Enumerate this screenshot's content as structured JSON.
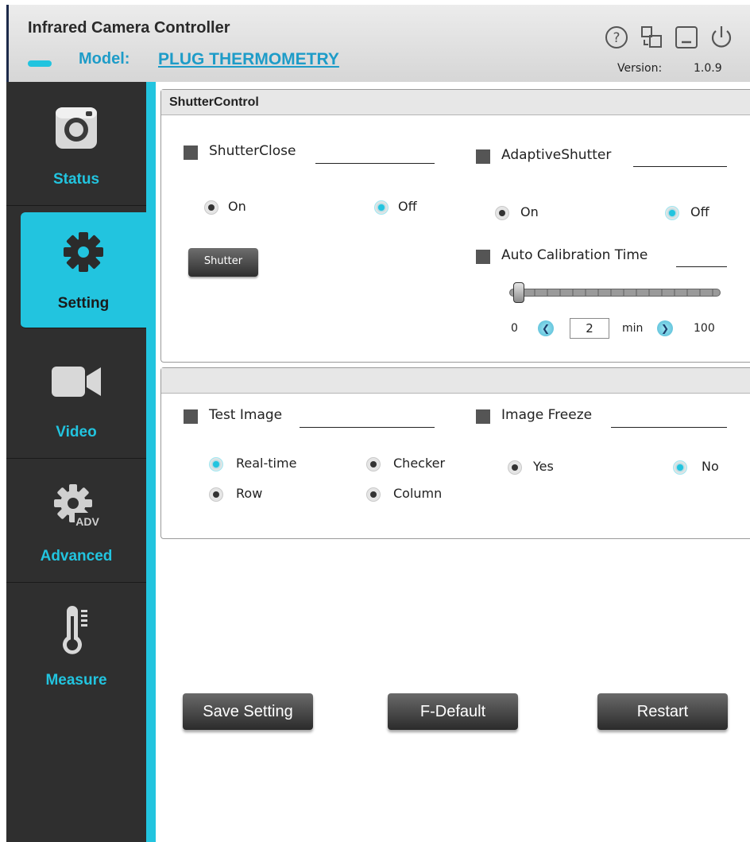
{
  "header": {
    "title": "Infrared Camera Controller",
    "model_label": "Model:",
    "model_value": "PLUG THERMOMETRY",
    "version_label": "Version:",
    "version_value": "1.0.9",
    "icons": [
      "help-icon",
      "window-switch-icon",
      "minimize-icon",
      "power-icon"
    ]
  },
  "sidebar": {
    "items": [
      {
        "label": "Status",
        "icon": "camera-icon",
        "active": false
      },
      {
        "label": "Setting",
        "icon": "gear-icon",
        "active": true
      },
      {
        "label": "Video",
        "icon": "video-camera-icon",
        "active": false
      },
      {
        "label": "Advanced",
        "icon": "gear-adv-icon",
        "active": false,
        "icon_text": "ADV"
      },
      {
        "label": "Measure",
        "icon": "thermometer-icon",
        "active": false
      }
    ]
  },
  "shutter_panel": {
    "title": "ShutterControl",
    "shutter_close": {
      "label": "ShutterClose",
      "options": [
        {
          "label": "On",
          "selected": false
        },
        {
          "label": "Off",
          "selected": true
        }
      ]
    },
    "shutter_button": "Shutter",
    "adaptive_shutter": {
      "label": "AdaptiveShutter",
      "options": [
        {
          "label": "On",
          "selected": false
        },
        {
          "label": "Off",
          "selected": true
        }
      ]
    },
    "auto_calibration": {
      "label": "Auto Calibration Time",
      "min": "0",
      "max": "100",
      "value": "2",
      "unit": "min",
      "slider_fraction": 0.02
    }
  },
  "image_panel": {
    "title": "",
    "test_image": {
      "label": "Test Image",
      "options": [
        {
          "label": "Real-time",
          "selected": true
        },
        {
          "label": "Checker",
          "selected": false
        },
        {
          "label": "Row",
          "selected": false
        },
        {
          "label": "Column",
          "selected": false
        }
      ]
    },
    "image_freeze": {
      "label": "Image Freeze",
      "options": [
        {
          "label": "Yes",
          "selected": false
        },
        {
          "label": "No",
          "selected": true
        }
      ]
    }
  },
  "actions": {
    "save": "Save Setting",
    "default": "F-Default",
    "restart": "Restart"
  },
  "colors": {
    "accent": "#22c4df",
    "sidebar_bg": "#2f2f2f",
    "link": "#1e9cc8"
  }
}
